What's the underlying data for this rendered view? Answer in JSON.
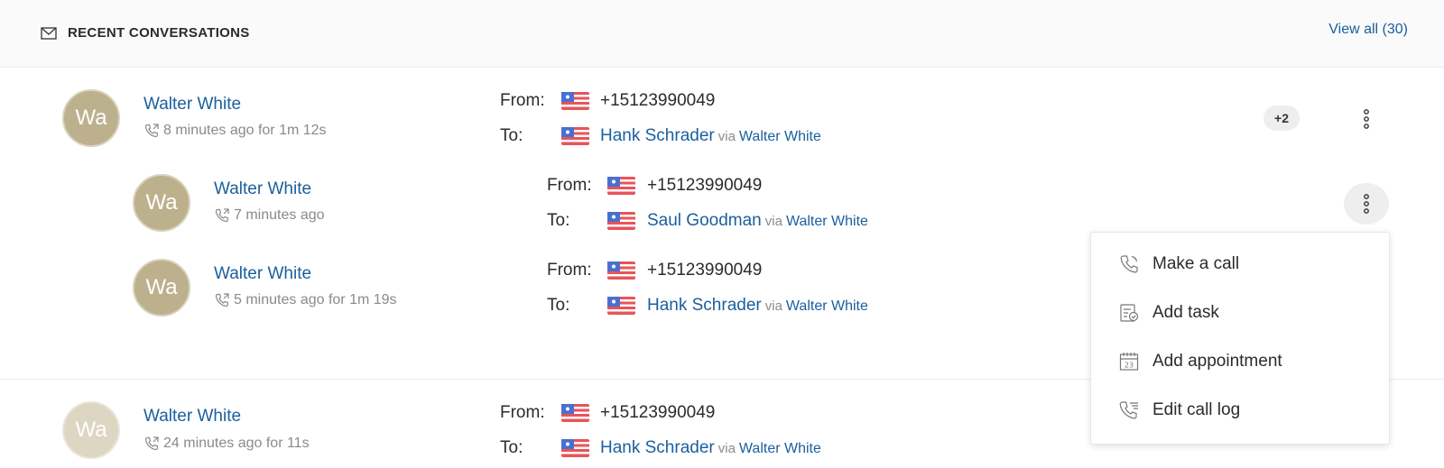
{
  "header": {
    "title": "RECENT CONVERSATIONS",
    "view_all": "View all (30)",
    "icon": "envelope-icon"
  },
  "conversations": [
    {
      "avatar": "Wa",
      "name": "Walter White",
      "meta": "8 minutes ago for 1m 12s",
      "from_label": "From:",
      "from_number": "+15123990049",
      "to_label": "To:",
      "to_name": "Hank Schrader",
      "via": "via",
      "via_name": "Walter White",
      "badge": "+2"
    },
    {
      "avatar": "Wa",
      "name": "Walter White",
      "meta": "7 minutes ago",
      "from_label": "From:",
      "from_number": "+15123990049",
      "to_label": "To:",
      "to_name": "Saul Goodman",
      "via": "via",
      "via_name": "Walter White"
    },
    {
      "avatar": "Wa",
      "name": "Walter White",
      "meta": "5 minutes ago for 1m 19s",
      "from_label": "From:",
      "from_number": "+15123990049",
      "to_label": "To:",
      "to_name": "Hank Schrader",
      "via": "via",
      "via_name": "Walter White"
    },
    {
      "avatar": "Wa",
      "name": "Walter White",
      "meta": "24 minutes ago for 11s",
      "from_label": "From:",
      "from_number": "+15123990049",
      "to_label": "To:",
      "to_name": "Hank Schrader",
      "via": "via",
      "via_name": "Walter White"
    }
  ],
  "menu": {
    "items": [
      {
        "label": "Make a call",
        "icon": "phone-icon"
      },
      {
        "label": "Add task",
        "icon": "task-icon"
      },
      {
        "label": "Add appointment",
        "icon": "calendar-icon"
      },
      {
        "label": "Edit call log",
        "icon": "call-log-icon"
      }
    ]
  },
  "colors": {
    "link": "#1a5f9e",
    "avatar": "#bdb08c",
    "muted": "#8a8a8a"
  }
}
